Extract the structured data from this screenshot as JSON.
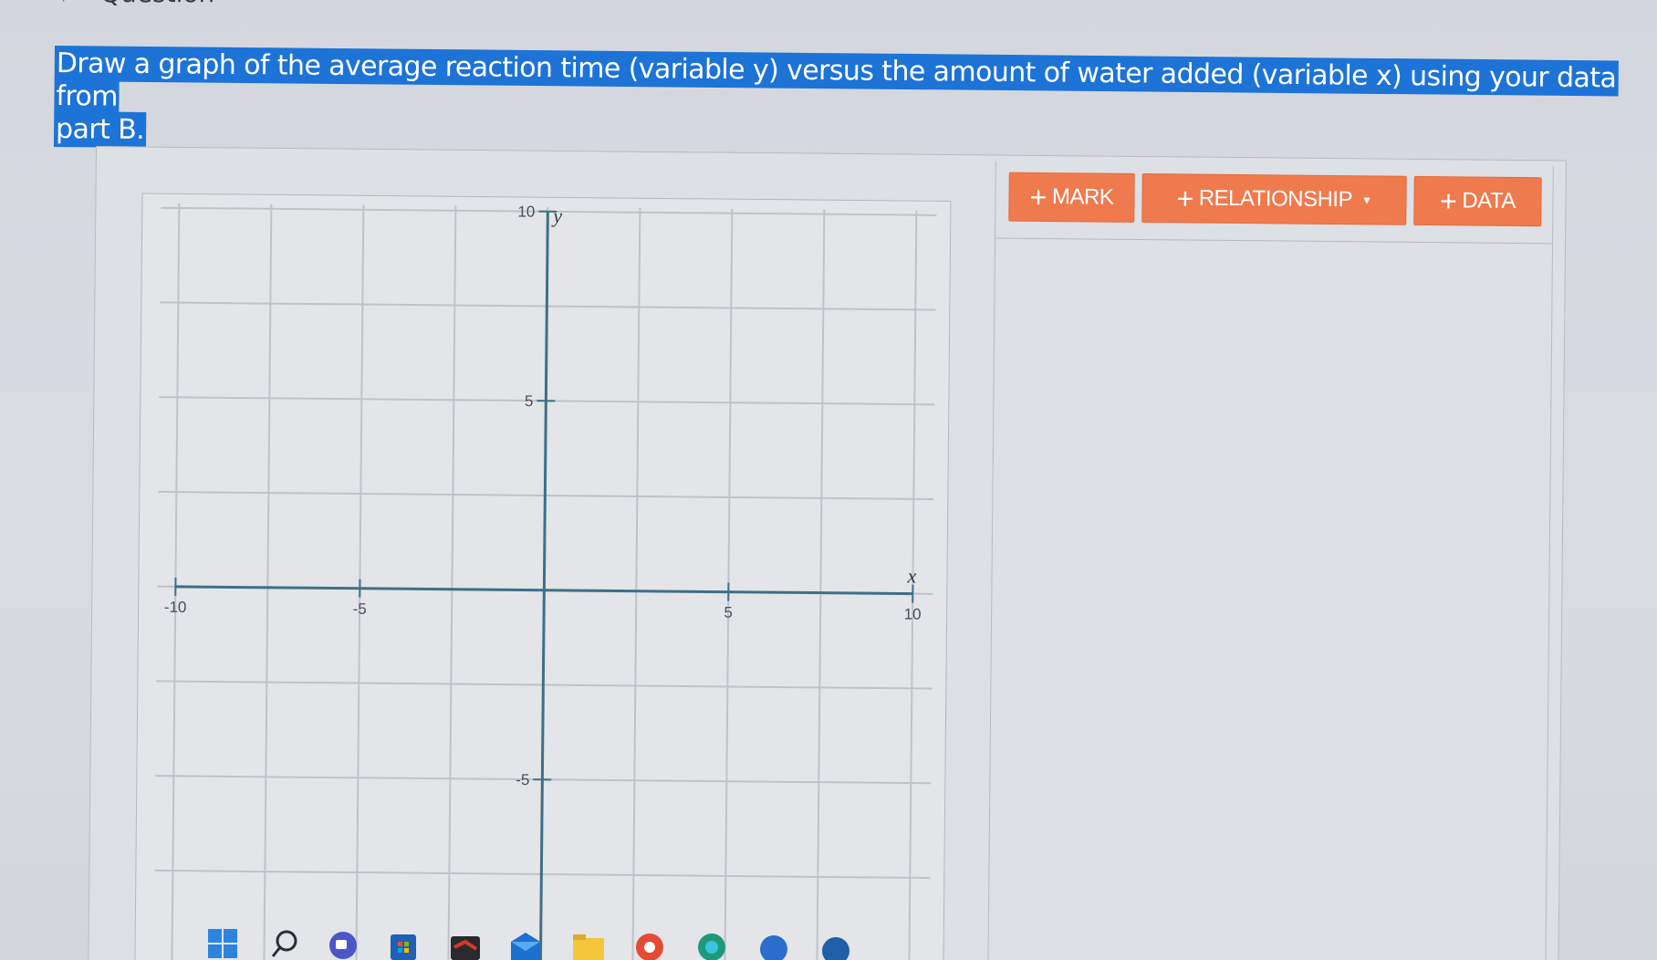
{
  "page": {
    "heading": "Question"
  },
  "question": {
    "line1": "Draw a graph of the average reaction time (variable y) versus the amount of water added (variable x) using your data from",
    "line2": "part B."
  },
  "toolbar": {
    "mark_label": "MARK",
    "relationship_label": "RELATIONSHIP",
    "data_label": "DATA",
    "plus_icon": "plus-icon",
    "caret_icon": "chevron-down-icon",
    "button_color": "#ef7a4e"
  },
  "graph": {
    "x_axis_label": "x",
    "y_axis_label": "y",
    "x_range": [
      -10,
      10
    ],
    "y_range": [
      -10,
      10
    ],
    "x_ticks": [
      {
        "value": -10,
        "label": "-10"
      },
      {
        "value": -5,
        "label": "-5"
      },
      {
        "value": 5,
        "label": "5"
      },
      {
        "value": 10,
        "label": "10"
      }
    ],
    "y_ticks": [
      {
        "value": 10,
        "label": "10"
      },
      {
        "value": 5,
        "label": "5"
      },
      {
        "value": -5,
        "label": "-5"
      }
    ],
    "grid_step": 2.5,
    "axis_color": "#3f6f86",
    "grid_color": "#bfc3c8"
  },
  "taskbar": {
    "icons": [
      "windows-start-icon",
      "search-icon",
      "meet-icon",
      "store-icon",
      "game-icon",
      "mail-icon",
      "file-explorer-icon",
      "chrome-icon",
      "edge-icon",
      "app-icon",
      "app-icon-2"
    ]
  }
}
